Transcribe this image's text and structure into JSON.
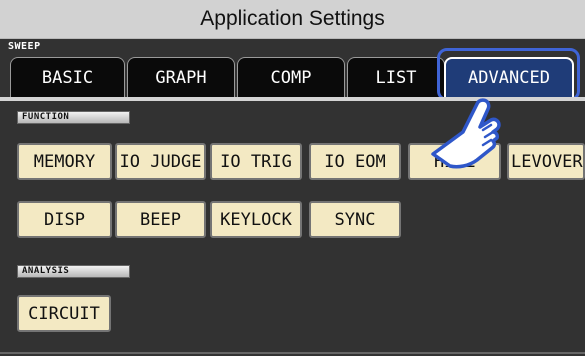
{
  "titlebar": {
    "title": "Application Settings"
  },
  "sweep_label": "SWEEP",
  "tabs": [
    {
      "id": "basic",
      "label": "BASIC"
    },
    {
      "id": "graph",
      "label": "GRAPH"
    },
    {
      "id": "comp",
      "label": "COMP"
    },
    {
      "id": "list",
      "label": "LIST"
    },
    {
      "id": "advanced",
      "label": "ADVANCED",
      "active": true
    }
  ],
  "function_section": {
    "title": "FUNCTION",
    "row1": [
      "MEMORY",
      "IO JUDGE",
      "IO TRIG",
      "IO EOM",
      "Hi Z",
      "LEVOVER"
    ],
    "row2": [
      "DISP",
      "BEEP",
      "KEYLOCK",
      "SYNC"
    ]
  },
  "analysis_section": {
    "title": "ANALYSIS",
    "buttons": [
      "CIRCUIT"
    ]
  },
  "colors": {
    "titlebar_bg": "#d2d2d2",
    "panel_bg": "#323232",
    "button_bg": "#f3e9c3",
    "active_tab_bg": "#1f3c78",
    "highlight": "#3f64d6"
  },
  "icons": {
    "pointer": "pointing-hand-icon"
  }
}
